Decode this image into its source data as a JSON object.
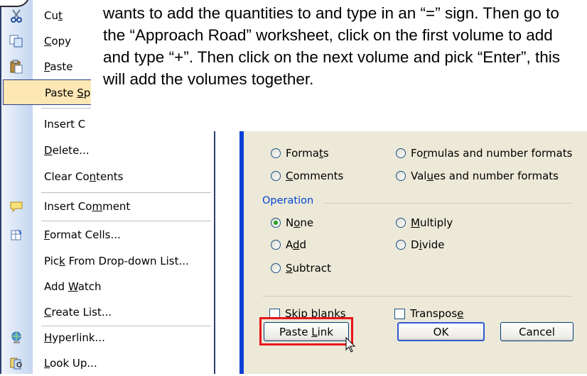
{
  "callout": {
    "text": "wants to add the quantities to and type in an “=” sign.  Then go to the “Approach Road” worksheet, click on the first volume to add and type “+”.  Then click on the next volume and pick “Enter”, this will add the volumes together."
  },
  "context_menu": {
    "items": [
      {
        "label_pre": "Cu",
        "label_u": "t",
        "label_post": "",
        "icon": "scissors-icon"
      },
      {
        "label_pre": "",
        "label_u": "C",
        "label_post": "opy",
        "icon": "copy-icon"
      },
      {
        "label_pre": "",
        "label_u": "P",
        "label_post": "aste",
        "icon": "paste-icon"
      },
      {
        "label_pre": "Paste ",
        "label_u": "S",
        "label_post": "p",
        "icon": ""
      },
      {
        "label_pre": "Insert C",
        "label_u": "",
        "label_post": "",
        "icon": ""
      },
      {
        "label_pre": "",
        "label_u": "D",
        "label_post": "elete...",
        "icon": ""
      },
      {
        "label_pre": "Clear Co",
        "label_u": "n",
        "label_post": "tents",
        "icon": ""
      },
      {
        "label_pre": "Insert Co",
        "label_u": "m",
        "label_post": "ment",
        "icon": "insert-comment-icon"
      },
      {
        "label_pre": "",
        "label_u": "F",
        "label_post": "ormat Cells...",
        "icon": "format-cells-icon"
      },
      {
        "label_pre": "Pic",
        "label_u": "k",
        "label_post": " From Drop-down List...",
        "icon": ""
      },
      {
        "label_pre": "Add ",
        "label_u": "W",
        "label_post": "atch",
        "icon": ""
      },
      {
        "label_pre": "",
        "label_u": "C",
        "label_post": "reate List...",
        "icon": ""
      },
      {
        "label_pre": "",
        "label_u": "H",
        "label_post": "yperlink...",
        "icon": "hyperlink-icon"
      },
      {
        "label_pre": "",
        "label_u": "L",
        "label_post": "ook Up...",
        "icon": "research-icon"
      }
    ]
  },
  "dialog": {
    "paste_options": [
      {
        "pre": "Forma",
        "u": "t",
        "post": "s",
        "checked": false
      },
      {
        "pre": "Fo",
        "u": "r",
        "post": "mulas and number formats",
        "checked": false
      },
      {
        "pre": "",
        "u": "C",
        "post": "omments",
        "checked": false
      },
      {
        "pre": "Val",
        "u": "u",
        "post": "es and number formats",
        "checked": false
      }
    ],
    "operation_title": "Operation",
    "operations": [
      {
        "pre": "N",
        "u": "o",
        "post": "ne",
        "checked": true
      },
      {
        "pre": "",
        "u": "M",
        "post": "ultiply",
        "checked": false
      },
      {
        "pre": "A",
        "u": "d",
        "post": "d",
        "checked": false
      },
      {
        "pre": "D",
        "u": "i",
        "post": "vide",
        "checked": false
      },
      {
        "pre": "",
        "u": "S",
        "post": "ubtract",
        "checked": false
      }
    ],
    "skip_blanks": {
      "pre": "Skip ",
      "u": "b",
      "post": "lanks",
      "checked": false
    },
    "transpose": {
      "pre": "Transpos",
      "u": "e",
      "post": "",
      "checked": false
    },
    "paste_link": {
      "pre": "Paste ",
      "u": "L",
      "post": "ink"
    },
    "ok_label": "OK",
    "cancel_label": "Cancel"
  },
  "colors": {
    "highlight": "#e8141c",
    "menu_selected": "#fde7b5",
    "dialog_bg": "#ece9d8",
    "selected_radio": "#21a121"
  }
}
